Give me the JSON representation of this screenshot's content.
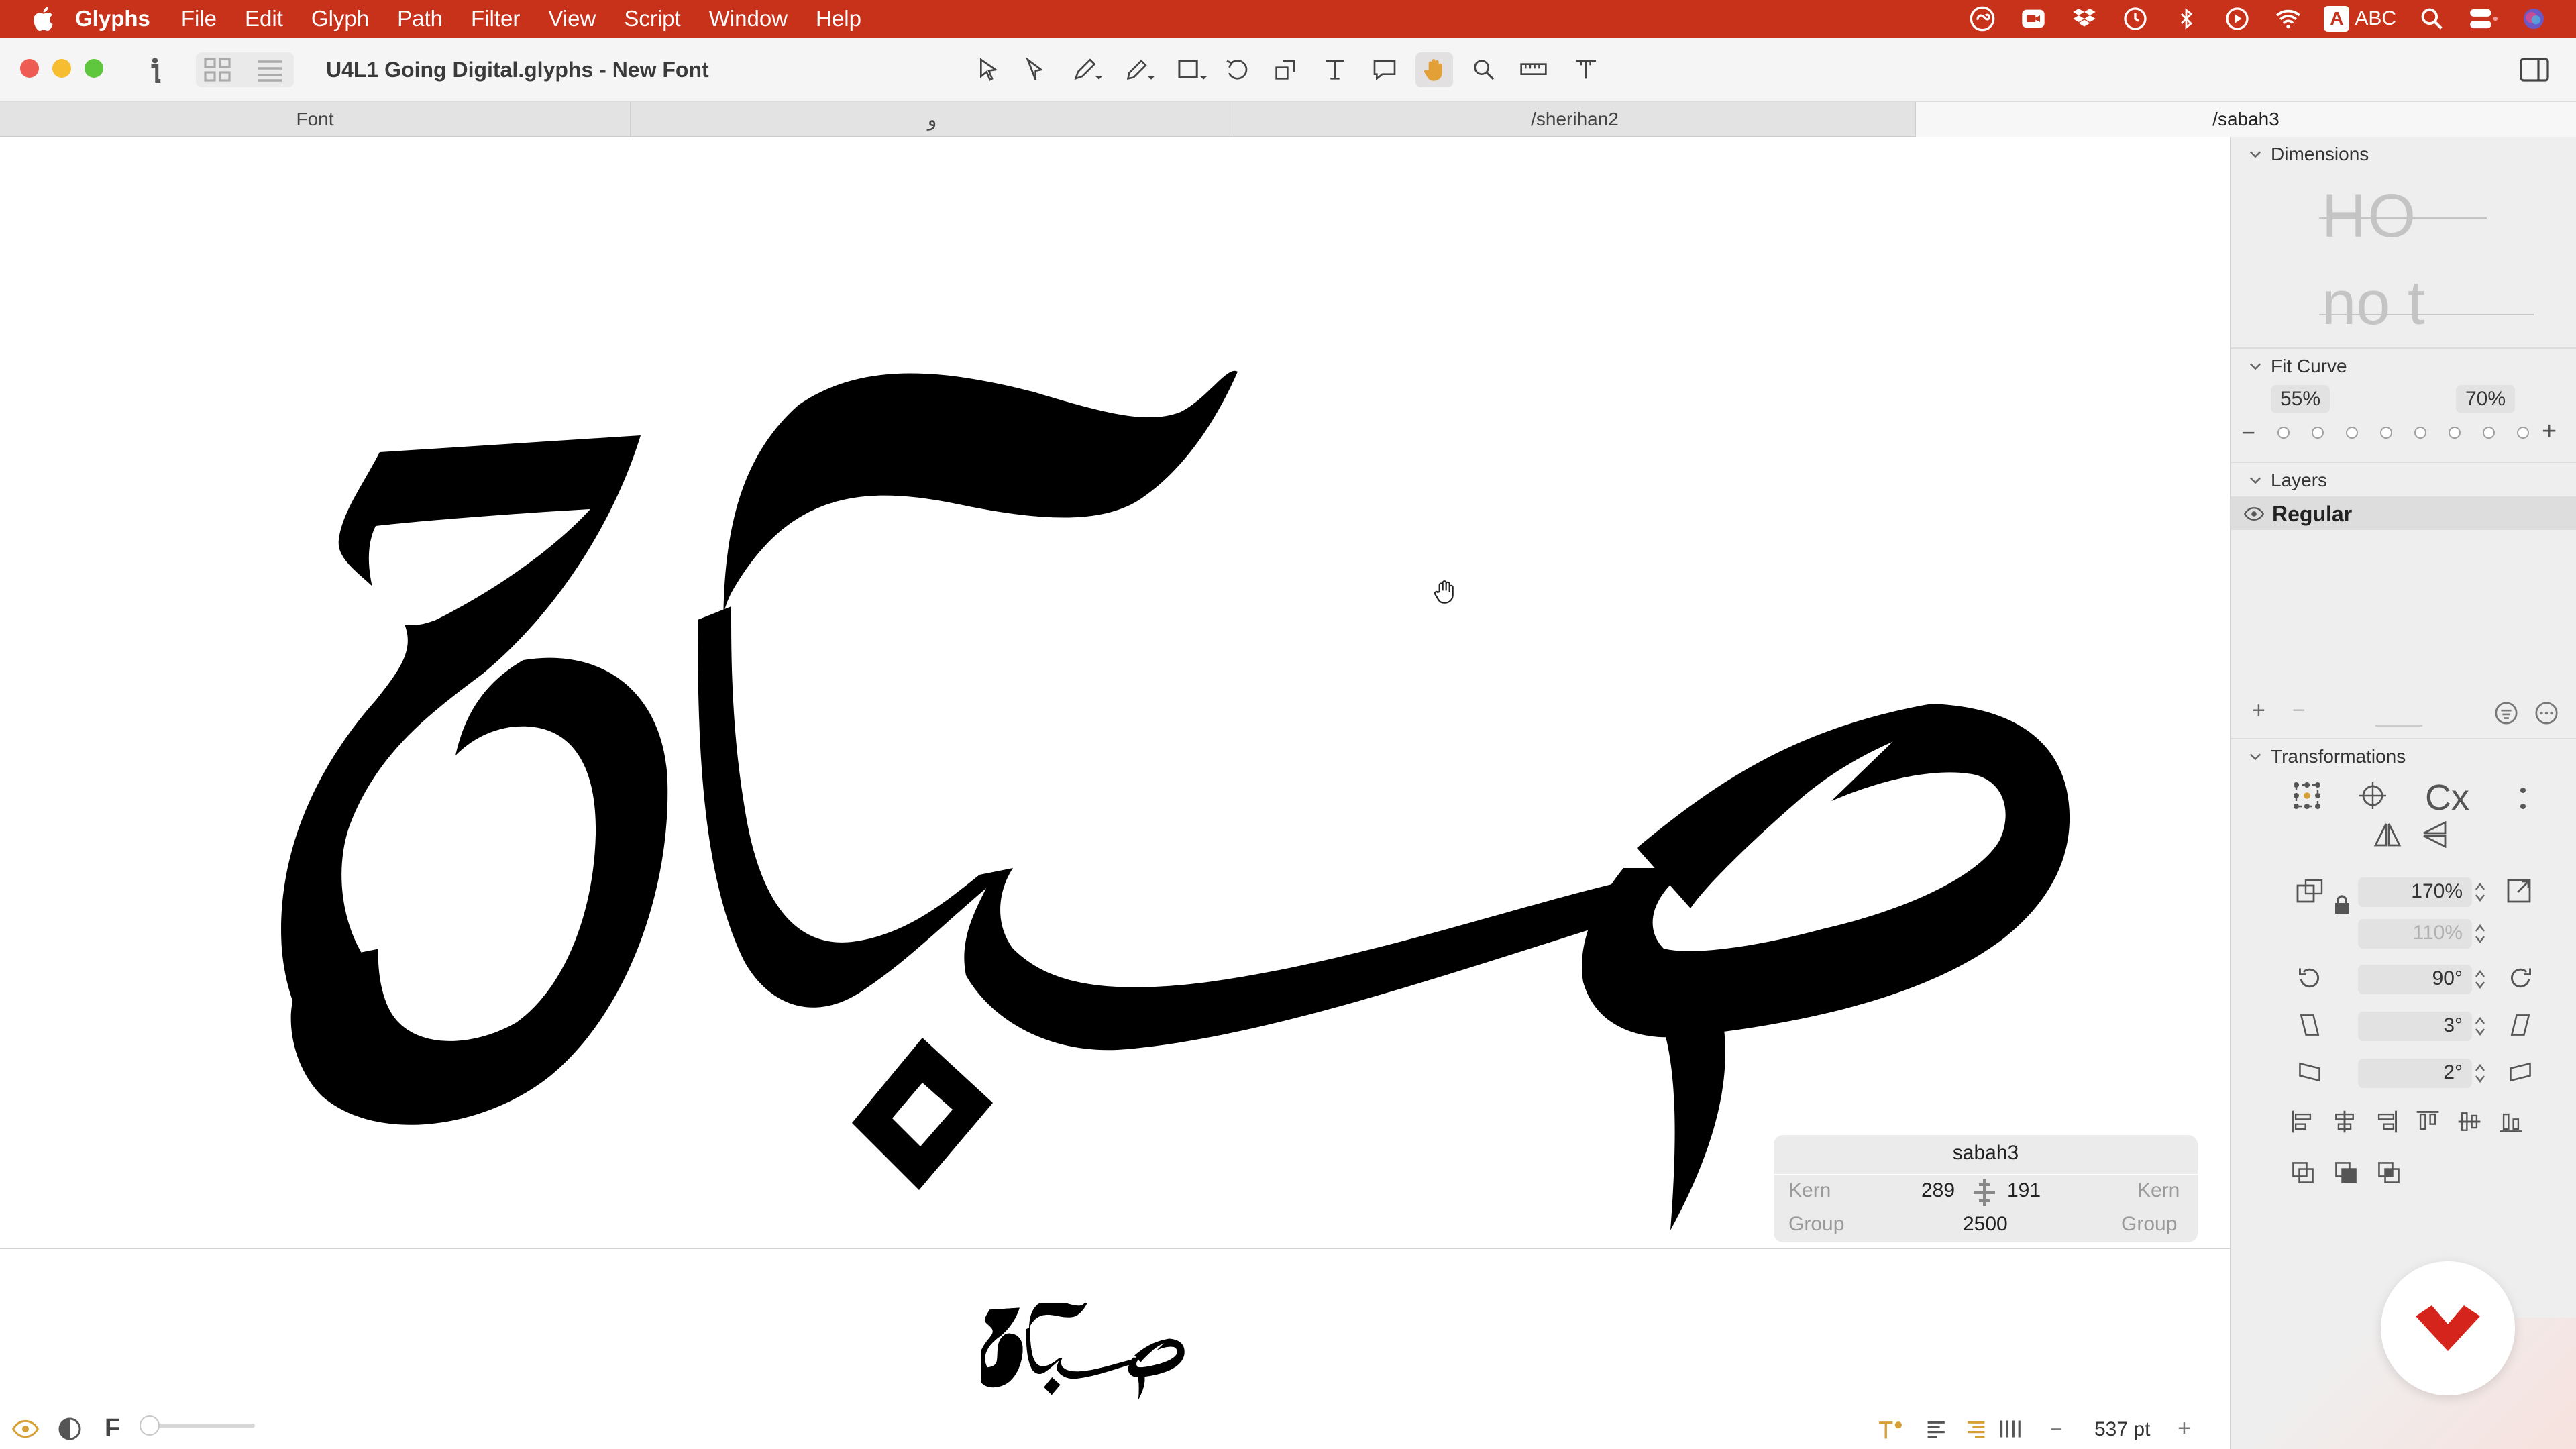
{
  "menubar": {
    "app_name": "Glyphs",
    "items": [
      "File",
      "Edit",
      "Glyph",
      "Path",
      "Filter",
      "View",
      "Script",
      "Window",
      "Help"
    ],
    "input_source": "ABC",
    "input_badge": "A",
    "status_icons": [
      "creative-cloud-icon",
      "facetime-icon",
      "dropbox-icon",
      "time-machine-icon",
      "bluetooth-icon",
      "play-icon",
      "wifi-icon",
      "search-icon",
      "control-center-icon",
      "siri-icon"
    ]
  },
  "window": {
    "title": "U4L1 Going Digital.glyphs - New Font",
    "tools": [
      "select-tool",
      "select-all-layers-tool",
      "draw-tool",
      "pencil-tool",
      "primitives-tool",
      "rotate-tool",
      "scale-tool",
      "text-tool",
      "annotation-tool",
      "hand-tool",
      "zoom-tool",
      "measurement-tool",
      "type-tool"
    ],
    "active_tool": "hand-tool"
  },
  "tabs": [
    {
      "label": "Font",
      "active": false
    },
    {
      "label": "و",
      "active": false
    },
    {
      "label": "/sherihan2",
      "active": false
    },
    {
      "label": "/sabah3",
      "active": true
    }
  ],
  "canvas": {
    "glyph_info": {
      "name": "sabah3",
      "left_label": "Kern",
      "right_label": "Kern",
      "lsb": "289",
      "rsb": "191",
      "group_left": "Group",
      "group_right": "Group",
      "width": "2500"
    }
  },
  "bottombar": {
    "font_letter": "F",
    "zoom": "537 pt"
  },
  "sidebar": {
    "dimensions": {
      "title": "Dimensions",
      "preview_text_top": "HO",
      "preview_text_bottom": "no t"
    },
    "fit_curve": {
      "title": "Fit Curve",
      "min": "55%",
      "max": "70%",
      "minus": "−",
      "plus": "+",
      "dots": 8
    },
    "layers": {
      "title": "Layers",
      "items": [
        {
          "name": "Regular",
          "selected": true
        }
      ],
      "add": "+",
      "remove": "−"
    },
    "transformations": {
      "title": "Transformations",
      "transform_origin_label": "Cx",
      "scale_x": "170%",
      "scale_y": "110%",
      "rotate": "90°",
      "slant_x": "3°",
      "slant_y": "2°"
    }
  },
  "colors": {
    "menubar": "#c8321a",
    "toolbar": "#f6f5f5",
    "sidebar": "#efeeee",
    "glyph": "#000000",
    "badge_red": "#d4241b"
  }
}
